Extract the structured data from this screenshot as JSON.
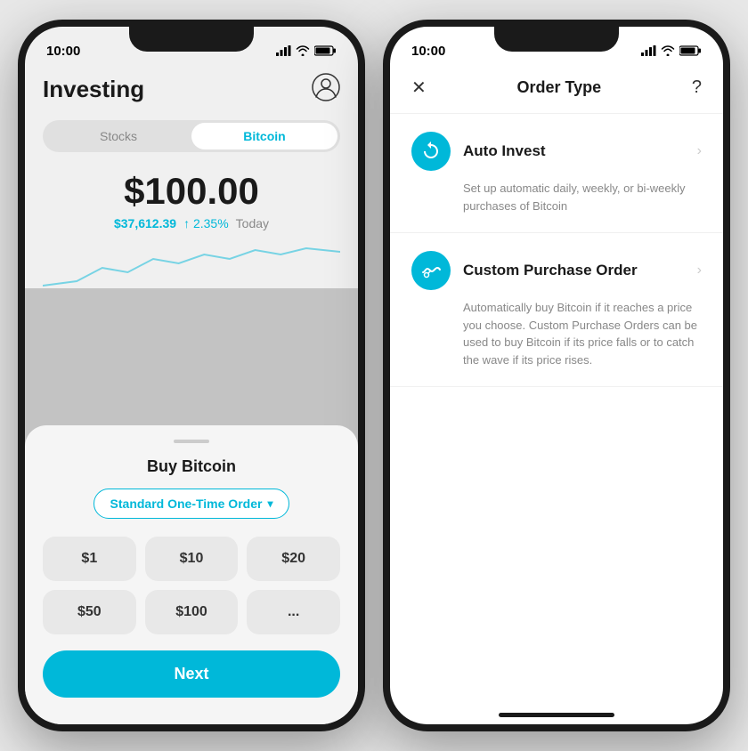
{
  "left_phone": {
    "status_bar": {
      "time": "10:00"
    },
    "header": {
      "title": "Investing"
    },
    "tabs": [
      {
        "label": "Stocks",
        "active": false
      },
      {
        "label": "Bitcoin",
        "active": true
      }
    ],
    "price": {
      "main": "$100.00",
      "btc": "$37,612.39",
      "change": "↑ 2.35%",
      "period": "Today"
    },
    "bottom_sheet": {
      "title": "Buy Bitcoin",
      "order_type": "Standard One-Time Order",
      "amounts": [
        "$1",
        "$10",
        "$20",
        "$50",
        "$100",
        "..."
      ],
      "next_button": "Next"
    }
  },
  "right_phone": {
    "status_bar": {
      "time": "10:00"
    },
    "header": {
      "title": "Order Type",
      "close": "✕",
      "help": "?"
    },
    "options": [
      {
        "name": "Auto Invest",
        "description": "Set up automatic daily, weekly, or bi-weekly purchases of Bitcoin",
        "icon_type": "refresh"
      },
      {
        "name": "Custom Purchase Order",
        "description": "Automatically buy Bitcoin if it reaches a price you choose. Custom Purchase Orders can be used to buy Bitcoin if its price falls or to catch the wave if its price rises.",
        "icon_type": "custom"
      }
    ]
  }
}
